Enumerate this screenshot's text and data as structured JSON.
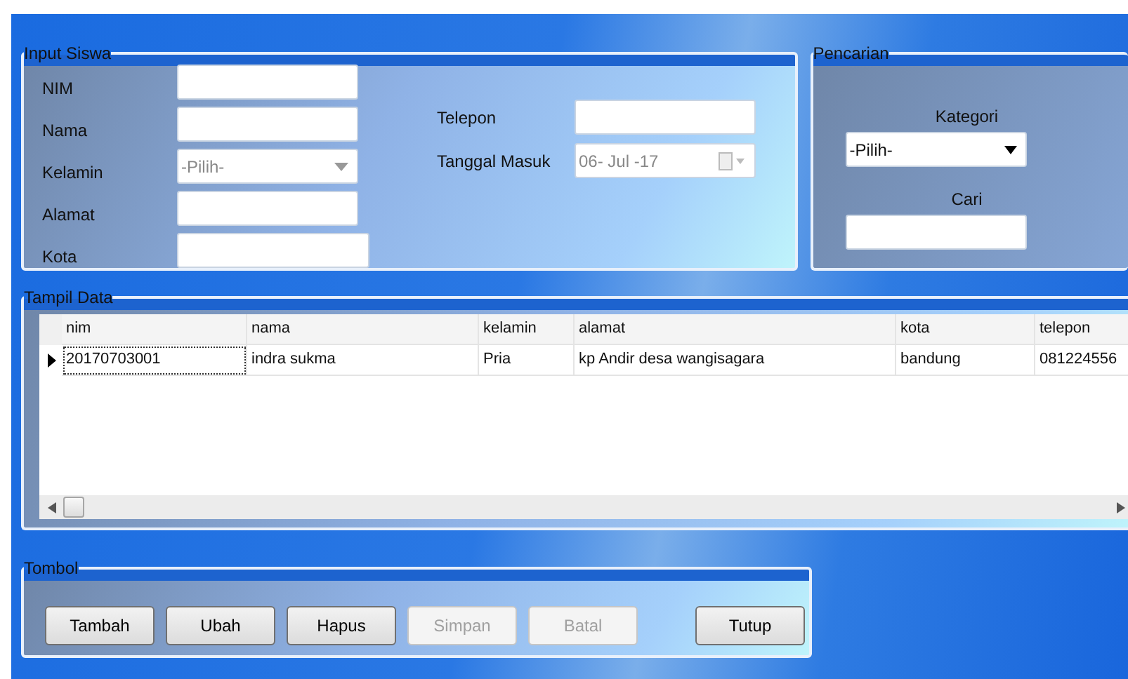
{
  "input_siswa": {
    "title": "Input Siswa",
    "left_fields": [
      {
        "label": "NIM",
        "kind": "text"
      },
      {
        "label": "Nama",
        "kind": "text"
      },
      {
        "label": "Kelamin",
        "kind": "select",
        "value": "-Pilih-"
      },
      {
        "label": "Alamat",
        "kind": "text"
      },
      {
        "label": "Kota",
        "kind": "text",
        "wide": true
      }
    ],
    "right_fields": [
      {
        "label": "Telepon",
        "kind": "text"
      },
      {
        "label": "Tanggal Masuk",
        "kind": "date",
        "value": "06- Jul -17"
      }
    ]
  },
  "pencarian": {
    "title": "Pencarian",
    "category_label": "Kategori",
    "category_value": "-Pilih-",
    "search_label": "Cari"
  },
  "tampil_data": {
    "title": "Tampil Data",
    "columns": [
      "nim",
      "nama",
      "kelamin",
      "alamat",
      "kota",
      "telepon"
    ],
    "rows": [
      {
        "selected": true,
        "cells": [
          "20170703001",
          "indra sukma",
          "Pria",
          "kp Andir desa wangisagara",
          "bandung",
          "081224556"
        ]
      }
    ]
  },
  "tombol": {
    "title": "Tombol",
    "buttons": [
      {
        "label": "Tambah",
        "disabled": false
      },
      {
        "label": "Ubah",
        "disabled": false
      },
      {
        "label": "Hapus",
        "disabled": false
      },
      {
        "label": "Simpan",
        "disabled": true
      },
      {
        "label": "Batal",
        "disabled": true
      },
      {
        "label": "Tutup",
        "disabled": false,
        "separated": true
      }
    ]
  }
}
